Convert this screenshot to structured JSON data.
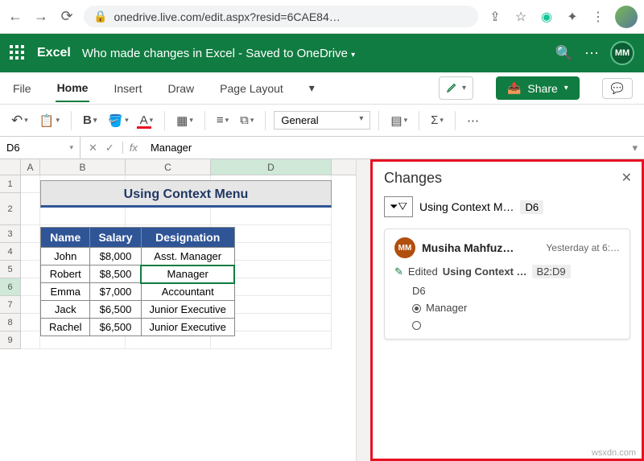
{
  "browser": {
    "url": "onedrive.live.com/edit.aspx?resid=6CAE84…"
  },
  "titlebar": {
    "app": "Excel",
    "doc": "Who made changes in Excel - Saved to OneDrive",
    "avatar": "MM"
  },
  "ribbon": {
    "tabs": [
      "File",
      "Home",
      "Insert",
      "Draw",
      "Page Layout"
    ],
    "share": "Share",
    "number_format": "General"
  },
  "fx": {
    "namebox": "D6",
    "label": "fx",
    "value": "Manager"
  },
  "columns": [
    "A",
    "B",
    "C",
    "D"
  ],
  "rownums": [
    "1",
    "2",
    "3",
    "4",
    "5",
    "6",
    "7",
    "8",
    "9"
  ],
  "table_title": "Using Context Menu",
  "table": {
    "headers": [
      "Name",
      "Salary",
      "Designation"
    ],
    "rows": [
      [
        "John",
        "$8,000",
        "Asst. Manager"
      ],
      [
        "Robert",
        "$8,500",
        "Manager"
      ],
      [
        "Emma",
        "$7,000",
        "Accountant"
      ],
      [
        "Jack",
        "$6,500",
        "Junior Executive"
      ],
      [
        "Rachel",
        "$6,500",
        "Junior Executive"
      ]
    ]
  },
  "changes": {
    "title": "Changes",
    "filter_sheet": "Using Context M…",
    "filter_cell": "D6",
    "card": {
      "avatar": "MM",
      "user": "Musiha Mahfuz…",
      "time": "Yesterday at 6:…",
      "action": "Edited",
      "sheet": "Using Context …",
      "range": "B2:D9",
      "cell": "D6",
      "new_value": "Manager"
    }
  },
  "watermark": "wsxdn.com"
}
